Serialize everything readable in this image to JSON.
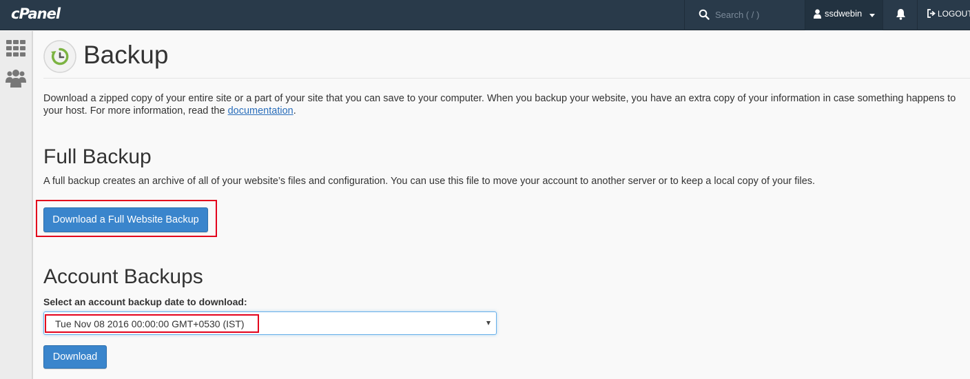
{
  "topbar": {
    "logo": "cPanel",
    "search_placeholder": "Search ( / )",
    "username": "ssdwebin",
    "logout_label": "LOGOUT"
  },
  "page": {
    "title": "Backup",
    "intro_text": "Download a zipped copy of your entire site or a part of your site that you can save to your computer. When you backup your website, you have an extra copy of your information in case something happens to your host. For more information, read the ",
    "intro_link": "documentation",
    "intro_end": "."
  },
  "full_backup": {
    "heading": "Full Backup",
    "description": "A full backup creates an archive of all of your website’s files and configuration. You can use this file to move your account to another server or to keep a local copy of your files.",
    "button_label": "Download a Full Website Backup"
  },
  "account_backups": {
    "heading": "Account Backups",
    "select_label": "Select an account backup date to download:",
    "selected_date": "Tue Nov 08 2016 00:00:00 GMT+0530 (IST)",
    "button_label": "Download"
  },
  "colors": {
    "topbar": "#293a4a",
    "button": "#3a85cc",
    "highlight": "#e3001b",
    "link": "#2a6ebb",
    "icon_green": "#7cb342"
  },
  "icons": {
    "search": "search-icon",
    "user": "user-icon",
    "bell": "bell-icon",
    "logout": "logout-icon",
    "grid": "grid-icon",
    "users": "users-icon",
    "backup": "backup-clock-icon"
  }
}
